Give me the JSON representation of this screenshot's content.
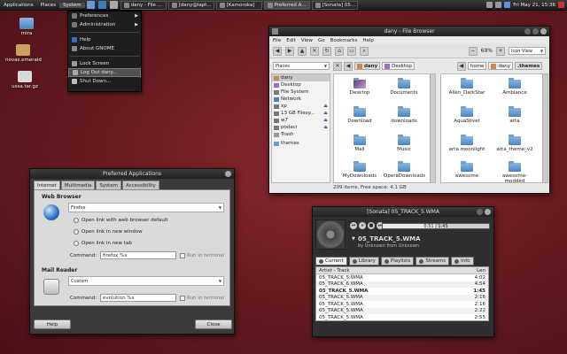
{
  "panel": {
    "menus": [
      "Applications",
      "Places",
      "System"
    ],
    "tasks": [
      "dany - File ...",
      "[dany@lapt...",
      "[Kamoroka]",
      "Preferred A...",
      "[Sonata] 05..."
    ],
    "clock": "Fri May 21, 15:36"
  },
  "system_menu": {
    "items": [
      {
        "label": "Preferences",
        "submenu": true
      },
      {
        "label": "Administration",
        "submenu": true
      },
      {
        "label": "Help"
      },
      {
        "label": "About GNOME"
      },
      {
        "label": "Lock Screen"
      },
      {
        "label": "Log Out dany..."
      },
      {
        "label": "Shut Down..."
      }
    ]
  },
  "desktop": {
    "icons": [
      "mira",
      "novas.emerald",
      "ussa.tar.gz"
    ]
  },
  "file_browser": {
    "title": "dany - File Browser",
    "menus": [
      "File",
      "Edit",
      "View",
      "Go",
      "Bookmarks",
      "Help"
    ],
    "zoom": "69%",
    "view_mode": "Icon View",
    "left_crumbs": [
      "dany",
      "Desktop"
    ],
    "right_crumbs": [
      "home",
      "dany",
      ".themes"
    ],
    "places_label": "Places",
    "places": [
      {
        "label": "dany"
      },
      {
        "label": "Desktop"
      },
      {
        "label": "File System"
      },
      {
        "label": "Network"
      },
      {
        "label": "xp",
        "eject": true
      },
      {
        "label": "13 GB Filesy...",
        "eject": true
      },
      {
        "label": "w7",
        "eject": true
      },
      {
        "label": "podaci",
        "eject": true
      },
      {
        "label": "Trash"
      },
      {
        "label": "themes"
      }
    ],
    "left_items": [
      "Desktop",
      "Documents",
      "Download",
      "downloads",
      "Mail",
      "Music",
      "MyDownloads",
      "OperaDownloads"
    ],
    "right_items": [
      "Alien_DarkStar",
      "Ambiance",
      "AquaSilver",
      "arta",
      "arta moonlight",
      "arta_theme_v2",
      "awesome",
      "awesome-modded"
    ],
    "status": "209 items, Free space: 4.1 GB"
  },
  "preferred_apps": {
    "title": "Preferred Applications",
    "tabs": [
      "Internet",
      "Multimedia",
      "System",
      "Accessibility"
    ],
    "web_browser": {
      "heading": "Web Browser",
      "selected": "Firefox",
      "options": [
        "Open link with web browser default",
        "Open link in new window",
        "Open link in new tab"
      ],
      "command_label": "Command:",
      "command": "firefox %s",
      "terminal_label": "Run in terminal"
    },
    "mail_reader": {
      "heading": "Mail Reader",
      "selected": "Custom",
      "command_label": "Command:",
      "command": "evolution %s",
      "terminal_label": "Run in terminal"
    },
    "help_label": "Help",
    "close_label": "Close"
  },
  "sonata": {
    "title": "[Sonata] 05_TRACK_5.WMA",
    "time": "0:51 / 1:45",
    "progress": 0.49,
    "track": "05_TRACK_5.WMA",
    "artist_line": "by Unknown from Unknown",
    "tabs": [
      "Current",
      "Library",
      "Playlists",
      "Streams",
      "Info"
    ],
    "columns": {
      "artist_track": "Artist - Track",
      "len": "Len"
    },
    "playlist": [
      {
        "track": "05_TRACK_5.WMA",
        "len": "4:02"
      },
      {
        "track": "05_TRACK_6.WMA",
        "len": "4:54"
      },
      {
        "track": "05_TRACK_5.WMA",
        "len": "1:45",
        "current": true
      },
      {
        "track": "05_TRACK_5.WMA",
        "len": "2:16"
      },
      {
        "track": "05_TRACK_5.WMA",
        "len": "2:16"
      },
      {
        "track": "05_TRACK_5.WMA",
        "len": "2:22"
      },
      {
        "track": "05_TRACK_5.WMA",
        "len": "2:55"
      }
    ]
  }
}
